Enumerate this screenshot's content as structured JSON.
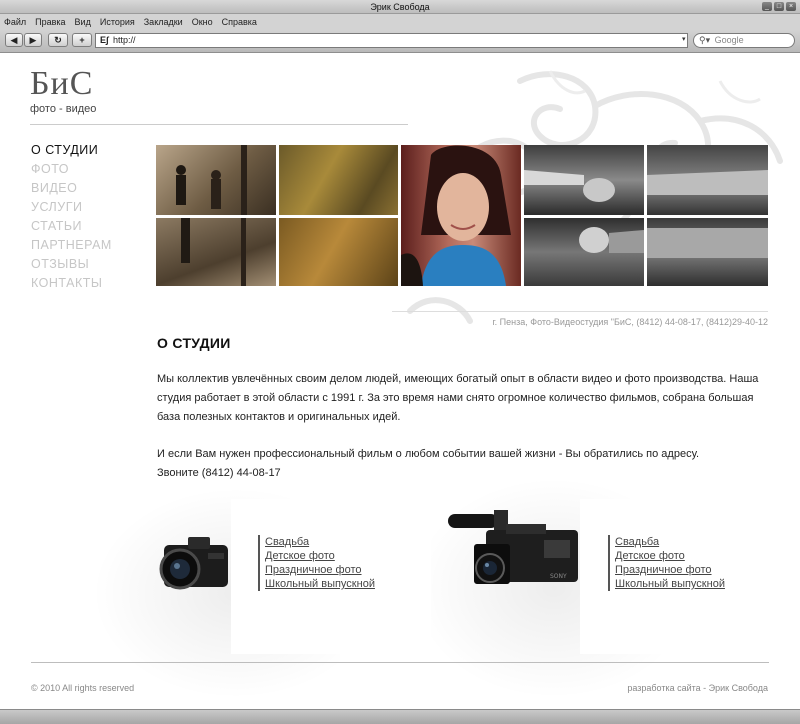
{
  "window": {
    "title": "Эрик Свобода"
  },
  "menu": [
    "Файл",
    "Правка",
    "Вид",
    "История",
    "Закладки",
    "Окно",
    "Справка"
  ],
  "toolbar": {
    "url": "http://",
    "search_placeholder": "Google"
  },
  "site": {
    "logo": "БиС",
    "logo_sub": "фото - видео",
    "nav": [
      {
        "label": "О СТУДИИ",
        "active": true
      },
      {
        "label": "ФОТО",
        "active": false
      },
      {
        "label": "ВИДЕО",
        "active": false
      },
      {
        "label": "УСЛУГИ",
        "active": false
      },
      {
        "label": "СТАТЬИ",
        "active": false
      },
      {
        "label": "ПАРТНЕРАМ",
        "active": false
      },
      {
        "label": "ОТЗЫВЫ",
        "active": false
      },
      {
        "label": "КОНТАКТЫ",
        "active": false
      }
    ],
    "address": "г. Пенза, Фото-Видеостудия \"БиС, (8412) 44-08-17, (8412)29-40-12",
    "section_title": "О СТУДИИ",
    "paragraph1": "Мы коллектив увлечённых своим делом людей, имеющих богатый опыт в области видео и фото  производства. Наша студия работает в этой области с 1991 г. За это время нами снято огромное  количество фильмов, собрана большая база полезных контактов и оригинальных идей.",
    "paragraph2_line1": "И если Вам нужен профессиональный  фильм о любом событии вашей жизни - Вы обратились по адресу.",
    "paragraph2_line2": "Звоните (8412) 44-08-17",
    "photo_links": [
      "Свадьба",
      "Детское фото",
      "Праздничное фото",
      "Школьный выпускной"
    ],
    "video_links": [
      "Свадьба",
      "Детское фото",
      "Праздничное фото",
      "Школьный выпускной"
    ],
    "copyright": "© 2010 All rights reserved",
    "credit": "разработка сайта - Эрик Свобода"
  },
  "colors": {
    "nav_inactive": "#c6c6c6",
    "nav_active": "#111111",
    "link": "#444444"
  }
}
